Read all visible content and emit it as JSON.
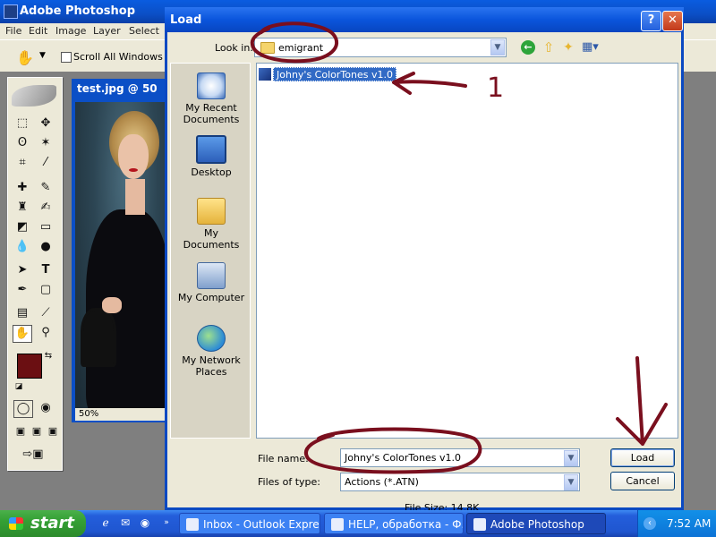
{
  "photoshop": {
    "title": "Adobe Photoshop",
    "menu": [
      "File",
      "Edit",
      "Image",
      "Layer",
      "Select"
    ],
    "options": {
      "scroll_all_windows": "Scroll All Windows"
    },
    "document": {
      "title": "test.jpg @ 50",
      "zoom": "50%"
    }
  },
  "dialog": {
    "title": "Load",
    "help_label": "?",
    "close_label": "✕",
    "look_in_label": "Look in:",
    "look_in_value": "emigrant",
    "places": [
      {
        "label": "My Recent Documents",
        "icon": "recent-documents-icon"
      },
      {
        "label": "Desktop",
        "icon": "desktop-icon"
      },
      {
        "label": "My Documents",
        "icon": "my-documents-icon"
      },
      {
        "label": "My Computer",
        "icon": "my-computer-icon"
      },
      {
        "label": "My Network Places",
        "icon": "network-places-icon"
      }
    ],
    "files": [
      {
        "name": "Johny's ColorTones v1.0",
        "selected": true
      }
    ],
    "file_name_label": "File name:",
    "file_name_value": "Johny's ColorTones v1.0",
    "file_type_label": "Files of type:",
    "file_type_value": "Actions (*.ATN)",
    "load_label": "Load",
    "cancel_label": "Cancel",
    "file_size": "File Size: 14.8K"
  },
  "annotations": {
    "number": "1",
    "color": "#7a0f1e"
  },
  "taskbar": {
    "start_label": "start",
    "tasks": [
      {
        "label": "Inbox - Outlook Express"
      },
      {
        "label": "HELP, обработка - Ф..."
      },
      {
        "label": "Adobe Photoshop"
      }
    ],
    "clock": "7:52 AM"
  },
  "colors": {
    "titlebar": "#0a55dc",
    "selection": "#316ac5",
    "foreground_swatch": "#6b0f12"
  }
}
